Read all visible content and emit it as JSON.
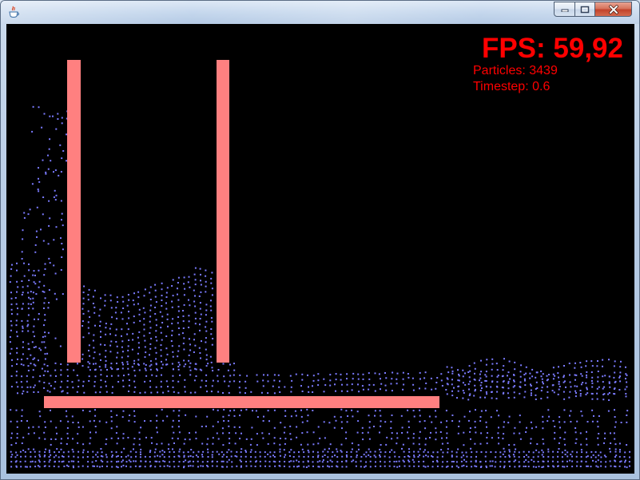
{
  "window": {
    "title": "",
    "icon": "java-icon",
    "controls": {
      "minimize_icon": "minimize-icon",
      "maximize_icon": "maximize-icon",
      "close_icon": "close-icon"
    }
  },
  "hud": {
    "fps_text": "FPS: 59,92",
    "particles_text": "Particles: 3439",
    "timestep_text": "Timestep: 0.6"
  },
  "scene": {
    "background_color": "#000000",
    "wall_color": "#ff8080",
    "particle_color": "#7b7bff",
    "hud_color": "#ff0000",
    "particle_count": 3439,
    "walls": [
      "left-vertical-wall",
      "right-vertical-wall",
      "horizontal-floor-wall"
    ]
  }
}
